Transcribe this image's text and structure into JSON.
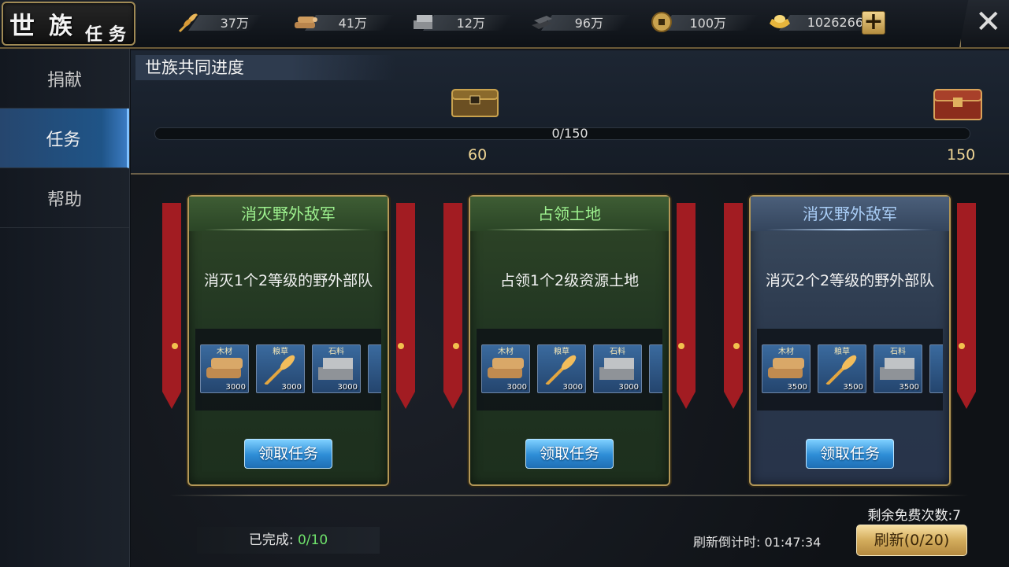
{
  "header": {
    "title_big": "世",
    "title_mid": "族",
    "title_small1": "任",
    "title_small2": "务",
    "resources": [
      {
        "icon": "grain-icon",
        "value": "37万"
      },
      {
        "icon": "wood-icon",
        "value": "41万"
      },
      {
        "icon": "stone-icon",
        "value": "12万"
      },
      {
        "icon": "iron-icon",
        "value": "96万"
      },
      {
        "icon": "copper-coin-icon",
        "value": "100万"
      },
      {
        "icon": "gold-ingot-icon",
        "value": "1026266"
      }
    ],
    "plus_label": "+",
    "close_label": "✕"
  },
  "sidebar": {
    "items": [
      {
        "label": "捐献",
        "active": false
      },
      {
        "label": "任务",
        "active": true
      },
      {
        "label": "帮助",
        "active": false
      }
    ]
  },
  "progress": {
    "title": "世族共同进度",
    "current": 0,
    "max": 150,
    "text": "0/150",
    "milestones": [
      "60",
      "150"
    ]
  },
  "tasks": [
    {
      "title": "消灭野外敌军",
      "desc": "消灭1个2等级的野外部队",
      "theme": "green",
      "rewards": [
        {
          "name": "木材",
          "qty": "3000"
        },
        {
          "name": "粮草",
          "qty": "3000"
        },
        {
          "name": "石料",
          "qty": "3000"
        }
      ],
      "button": "领取任务"
    },
    {
      "title": "占领土地",
      "desc": "占领1个2级资源土地",
      "theme": "green",
      "rewards": [
        {
          "name": "木材",
          "qty": "3000"
        },
        {
          "name": "粮草",
          "qty": "3000"
        },
        {
          "name": "石料",
          "qty": "3000"
        }
      ],
      "button": "领取任务"
    },
    {
      "title": "消灭野外敌军",
      "desc": "消灭2个2等级的野外部队",
      "theme": "blue",
      "rewards": [
        {
          "name": "木材",
          "qty": "3500"
        },
        {
          "name": "粮草",
          "qty": "3500"
        },
        {
          "name": "石料",
          "qty": "3500"
        }
      ],
      "button": "领取任务"
    }
  ],
  "footer": {
    "completed_label": "已完成: ",
    "completed_value": "0/10",
    "free_label": "剩余免费次数:7",
    "timer_label": "刷新倒计时: 01:47:34",
    "refresh_button": "刷新(0/20)"
  }
}
